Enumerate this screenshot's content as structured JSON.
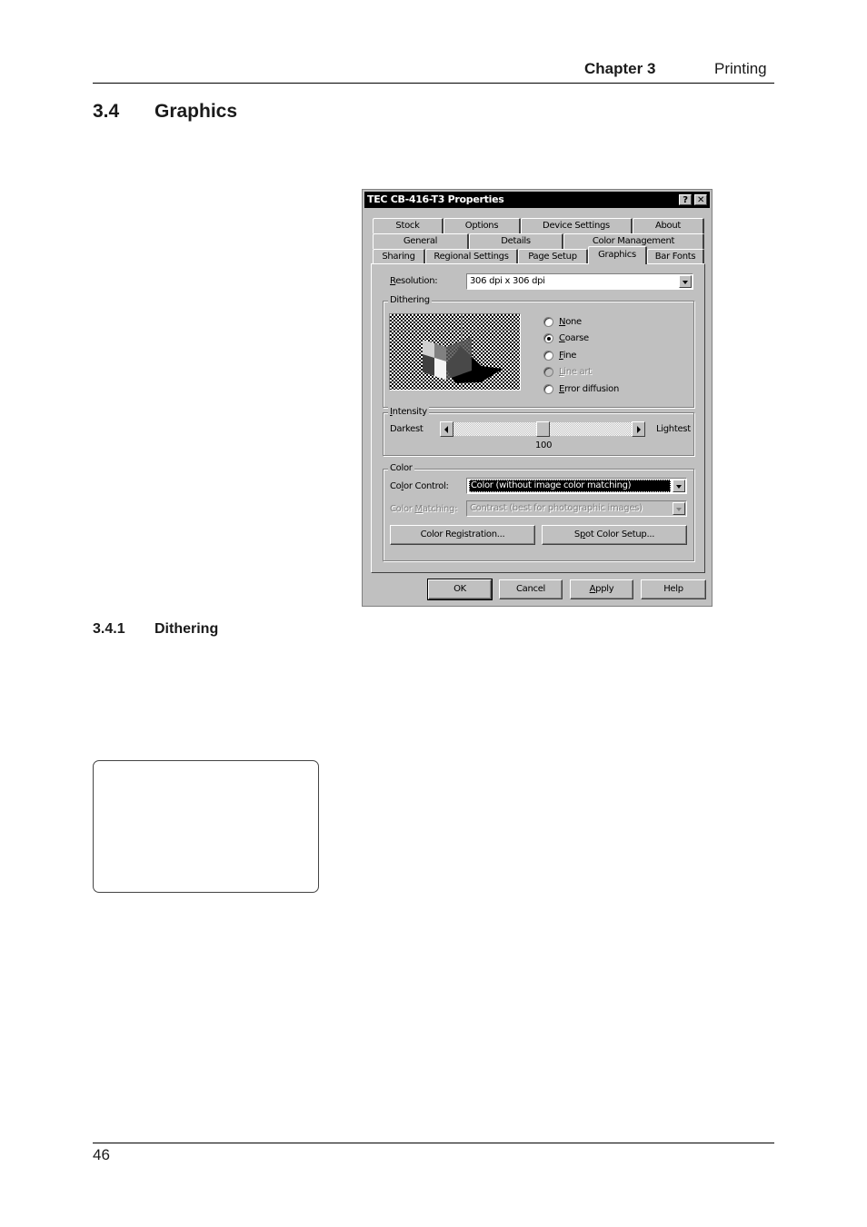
{
  "header": {
    "chapter": "Chapter 3",
    "title": "Printing"
  },
  "section": {
    "number": "3.4",
    "title": "Graphics"
  },
  "subsection": {
    "number": "3.4.1",
    "title": "Dithering"
  },
  "footer": {
    "page_number": "46"
  },
  "dialog": {
    "title": "TEC CB-416-T3 Properties",
    "help_button": "?",
    "close_button": "✕",
    "tabs_row1": [
      "Stock",
      "Options",
      "Device Settings",
      "About"
    ],
    "tabs_row2": [
      "General",
      "Details",
      "Color Management"
    ],
    "tabs_row3": [
      "Sharing",
      "Regional Settings",
      "Page Setup",
      "Graphics",
      "Bar Fonts"
    ],
    "active_tab": "Graphics",
    "resolution": {
      "label_mnemonic": "R",
      "label_rest": "esolution:",
      "value": "306 dpi x 306 dpi"
    },
    "dithering": {
      "group_label": "Dithering",
      "preview_icon": "dithering-preview-image",
      "options": [
        {
          "mnemonic": "N",
          "rest": "one",
          "checked": false,
          "enabled": true
        },
        {
          "mnemonic": "C",
          "rest": "oarse",
          "checked": true,
          "enabled": true
        },
        {
          "mnemonic": "F",
          "rest": "ine",
          "checked": false,
          "enabled": true
        },
        {
          "mnemonic": "L",
          "rest": "ine art",
          "checked": false,
          "enabled": false
        },
        {
          "mnemonic": "E",
          "rest": "rror diffusion",
          "checked": false,
          "enabled": true
        }
      ]
    },
    "intensity": {
      "group_mnemonic": "I",
      "group_rest": "ntensity",
      "min_label": "Darkest",
      "max_label": "Lightest",
      "value": "100",
      "position_fraction": 0.5
    },
    "color": {
      "group_label": "Color",
      "control_label_a": "Co",
      "control_label_mnemonic": "l",
      "control_label_b": "or Control:",
      "control_value": "Color (without image color matching)",
      "matching_label_a": "Color ",
      "matching_label_mnemonic": "M",
      "matching_label_b": "atching:",
      "matching_value": "Contrast (best for photographic images)",
      "registration_button_a": "Color Re",
      "registration_button_mnemonic": "g",
      "registration_button_b": "istration...",
      "spot_button_a": "S",
      "spot_button_mnemonic": "p",
      "spot_button_b": "ot Color Setup..."
    },
    "buttons": {
      "ok": "OK",
      "cancel": "Cancel",
      "apply_mnemonic": "A",
      "apply_rest": "pply",
      "help": "Help"
    }
  }
}
